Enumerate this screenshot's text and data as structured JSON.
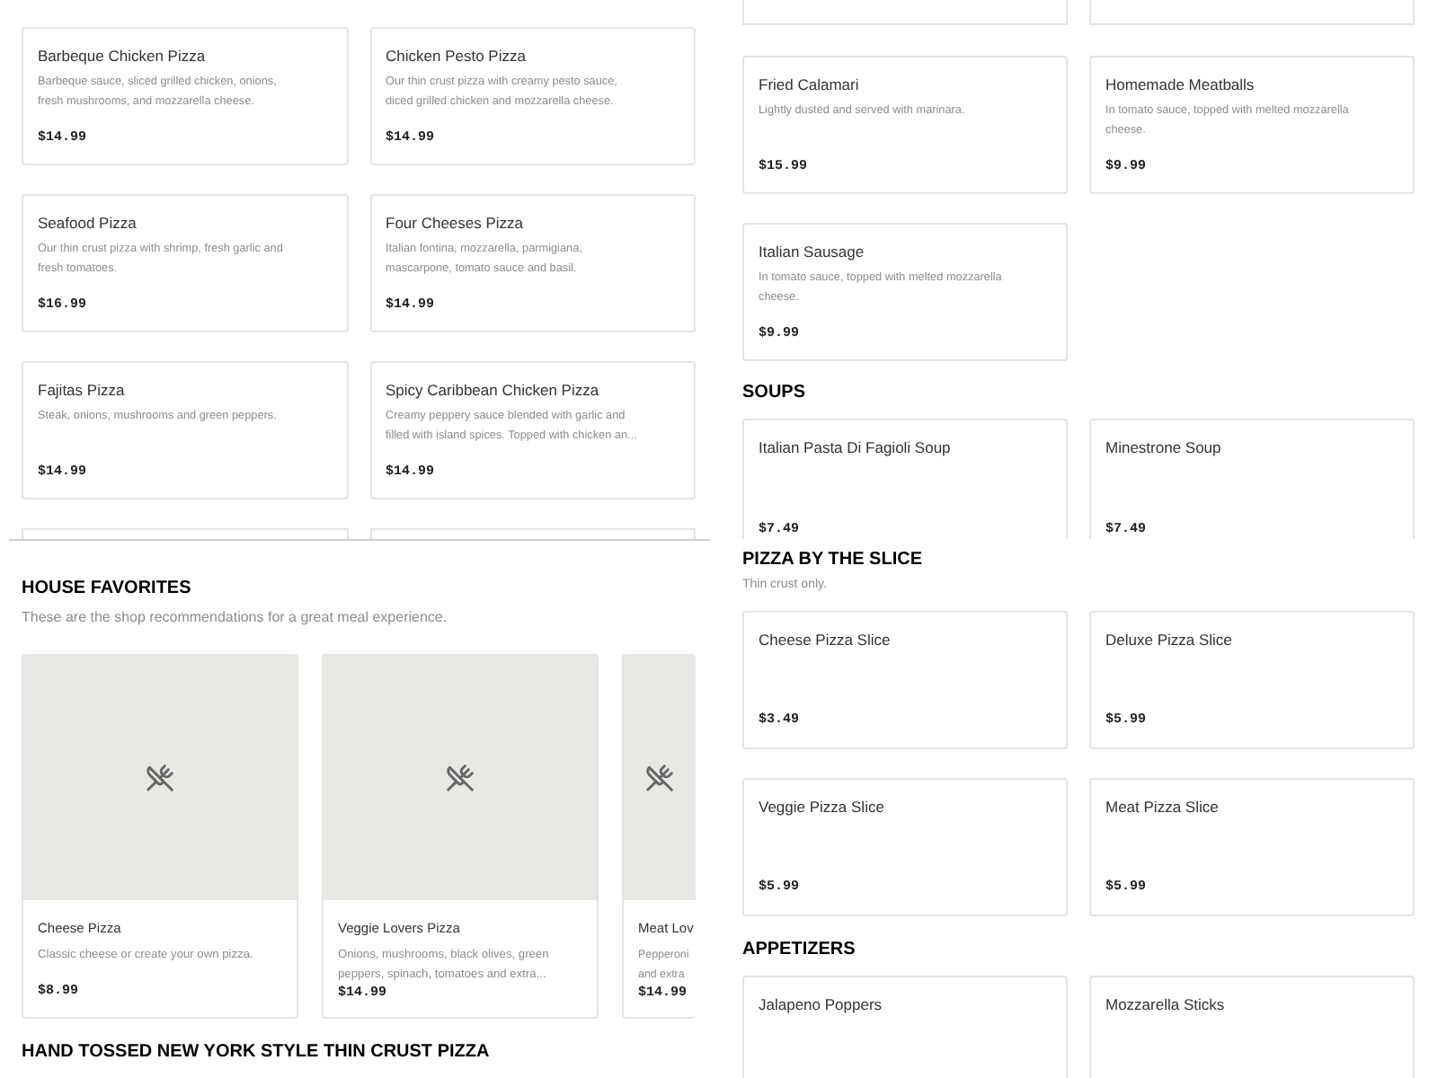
{
  "left_menu": {
    "items": [
      {
        "name": "Barbeque Chicken Pizza",
        "description": [
          "Barbeque sauce, sliced grilled chicken, onions,",
          "fresh mushrooms, and mozzarella cheese."
        ],
        "price": "$14.99"
      },
      {
        "name": "Chicken Pesto Pizza",
        "description": [
          "Our thin crust pizza with creamy pesto sauce,",
          "diced grilled chicken and mozzarella cheese."
        ],
        "price": "$14.99"
      },
      {
        "name": "Seafood Pizza",
        "description": [
          "Our thin crust pizza with shrimp, fresh garlic and",
          "fresh tomatoes."
        ],
        "price": "$16.99"
      },
      {
        "name": "Four Cheeses Pizza",
        "description": [
          "Italian fontina, mozzarella, parmigiana,",
          "mascarpone, tomato sauce and basil."
        ],
        "price": "$14.99"
      },
      {
        "name": "Fajitas Pizza",
        "description": [
          "Steak, onions, mushrooms and green peppers."
        ],
        "price": "$14.99"
      },
      {
        "name": "Spicy Caribbean Chicken Pizza",
        "description": [
          "Creamy peppery sauce blended with garlic and",
          "filled with island spices. Topped with chicken an..."
        ],
        "price": "$14.99"
      }
    ]
  },
  "house_favorites": {
    "title": "HOUSE FAVORITES",
    "subtitle": "These are the shop recommendations for a great meal experience.",
    "items": [
      {
        "name": "Cheese Pizza",
        "description": [
          "Classic cheese or create your own pizza."
        ],
        "price": "$8.99"
      },
      {
        "name": "Veggie Lovers Pizza",
        "description": [
          "Onions, mushrooms, black olives, green",
          "peppers, spinach, tomatoes and extra..."
        ],
        "price": "$14.99"
      },
      {
        "name": "Meat Lov",
        "description": [
          "Pepperoni",
          "and extra"
        ],
        "price": "$14.99"
      }
    ]
  },
  "next_section": {
    "title": "HAND TOSSED NEW YORK STYLE THIN CRUST PIZZA"
  },
  "right_top": {
    "items": [
      {
        "name": "Fried Calamari",
        "description": [
          "Lightly dusted and served with marinara."
        ],
        "price": "$15.99"
      },
      {
        "name": "Homemade Meatballs",
        "description": [
          "In tomato sauce, topped with melted mozzarella",
          "cheese."
        ],
        "price": "$9.99"
      },
      {
        "name": "Italian Sausage",
        "description": [
          "In tomato sauce, topped with melted mozzarella",
          "cheese."
        ],
        "price": "$9.99"
      }
    ],
    "sections": [
      {
        "title": "SOUPS",
        "items": [
          {
            "name": "Italian Pasta Di Fagioli Soup",
            "price": "$7.49"
          },
          {
            "name": "Minestrone Soup",
            "price": "$7.49"
          }
        ]
      }
    ]
  },
  "right_bottom": {
    "sections": [
      {
        "title": "PIZZA BY THE SLICE",
        "subtitle": "Thin crust only.",
        "items": [
          {
            "name": "Cheese Pizza Slice",
            "price": "$3.49"
          },
          {
            "name": "Deluxe Pizza Slice",
            "price": "$5.99"
          },
          {
            "name": "Veggie Pizza Slice",
            "price": "$5.99"
          },
          {
            "name": "Meat Pizza Slice",
            "price": "$5.99"
          }
        ]
      },
      {
        "title": "APPETIZERS",
        "items": [
          {
            "name": "Jalapeno Poppers"
          },
          {
            "name": "Mozzarella Sticks"
          }
        ]
      }
    ]
  }
}
